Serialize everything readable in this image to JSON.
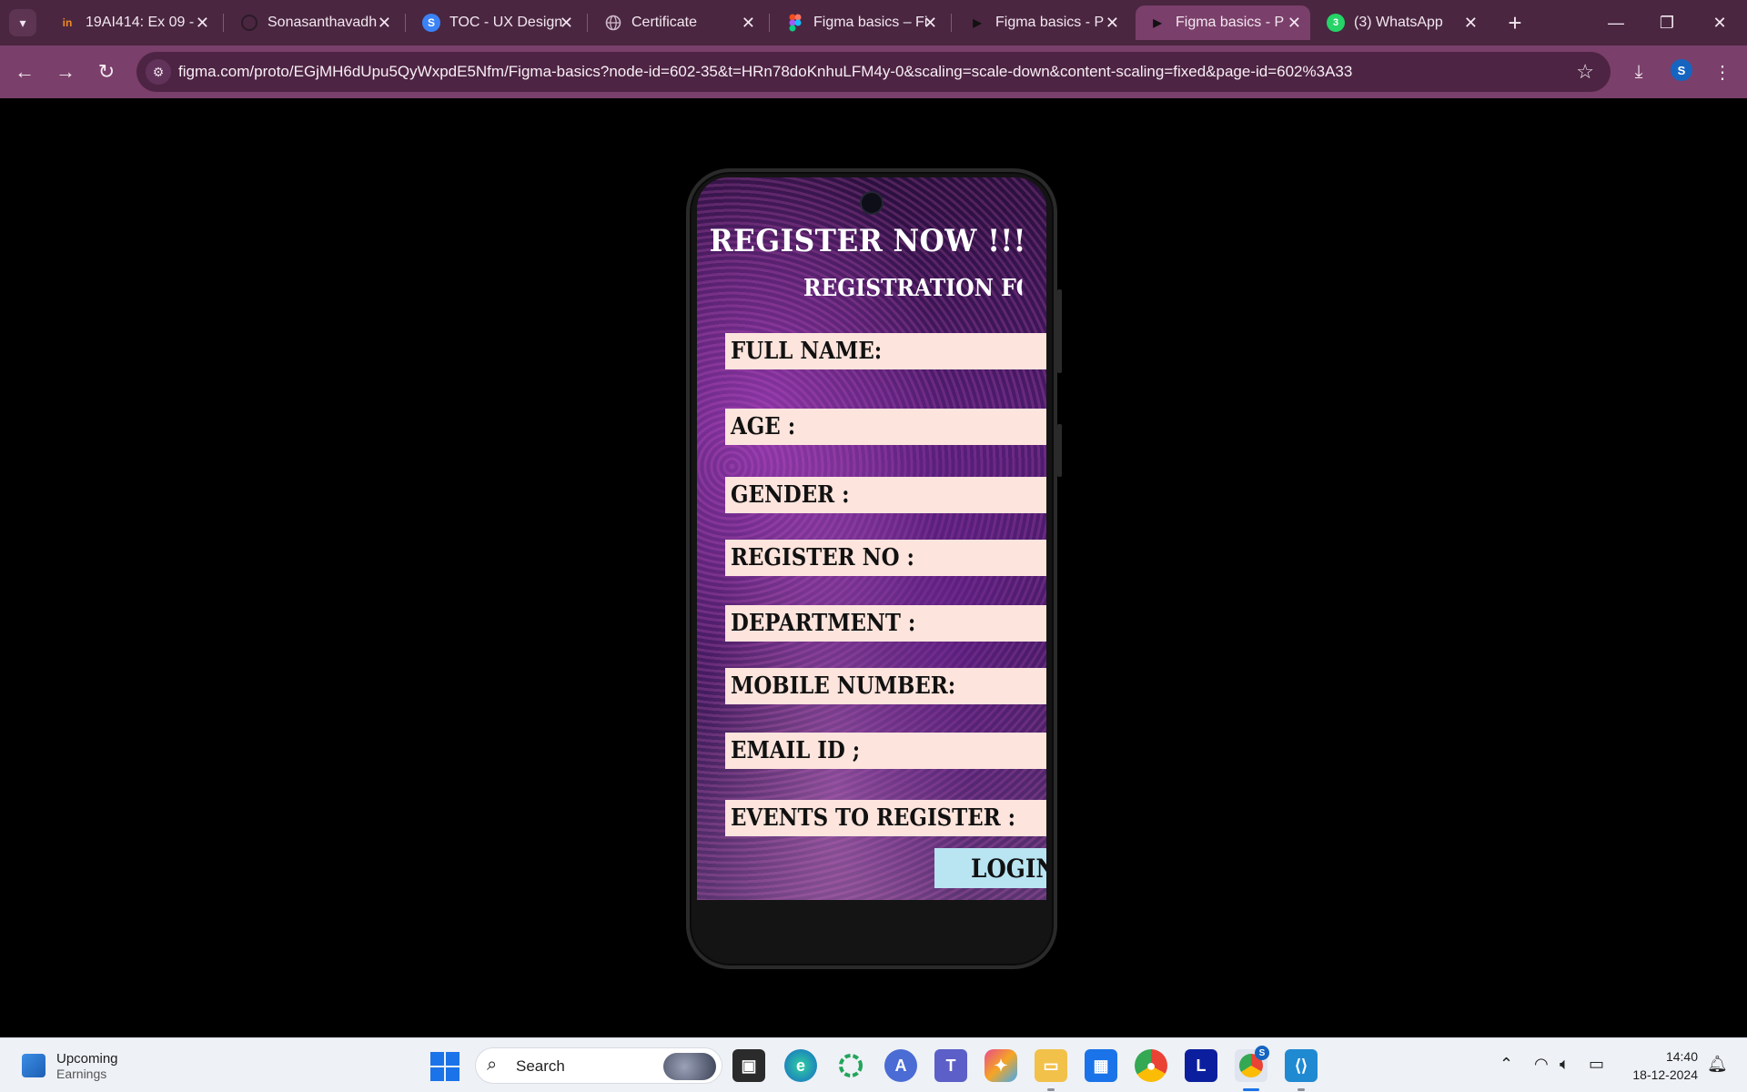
{
  "browser": {
    "tabs": [
      {
        "title": "19AI414: Ex 09 -",
        "favicon": "in"
      },
      {
        "title": "Sonasanthavadh",
        "favicon": "github-icon"
      },
      {
        "title": "TOC - UX Design",
        "favicon": "S"
      },
      {
        "title": "Certificate",
        "favicon": "globe-icon"
      },
      {
        "title": "Figma basics – Fi",
        "favicon": "figma-icon"
      },
      {
        "title": "Figma basics - P",
        "favicon": "play-icon"
      },
      {
        "title": "Figma basics - P",
        "favicon": "play-icon"
      },
      {
        "title": "(3) WhatsApp",
        "favicon": "3"
      }
    ],
    "active_tab_index": 6,
    "url": "figma.com/proto/EGjMH6dUpu5QyWxpdE5Nfm/Figma-basics?node-id=602-35&t=HRn78doKnhuLFM4y-0&scaling=scale-down&content-scaling=fixed&page-id=602%3A33",
    "profile_initial": "S"
  },
  "prototype": {
    "title": "REGISTER NOW !!!",
    "subtitle": "REGISTRATION FOR",
    "fields": [
      "FULL NAME:",
      "AGE :",
      "GENDER :",
      "REGISTER NO :",
      "DEPARTMENT :",
      "MOBILE NUMBER:",
      "EMAIL ID ;",
      "EVENTS TO REGISTER :"
    ],
    "login_label": "LOGIN"
  },
  "taskbar": {
    "widget_title": "Upcoming",
    "widget_subtitle": "Earnings",
    "search_placeholder": "Search",
    "chrome_badge": "S",
    "time": "14:40",
    "date": "18-12-2024"
  }
}
